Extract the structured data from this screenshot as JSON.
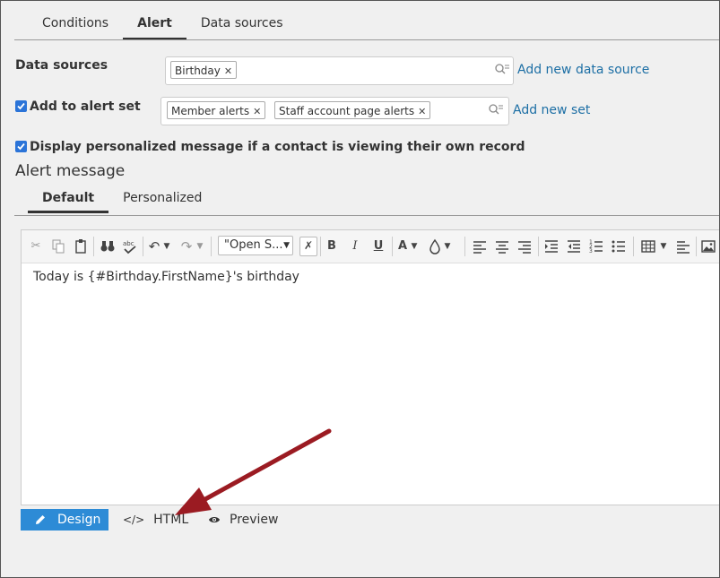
{
  "tabs_top": [
    "Conditions",
    "Alert",
    "Data sources"
  ],
  "active_tab_top": "Alert",
  "data_sources": {
    "label": "Data sources",
    "tags": [
      "Birthday"
    ],
    "add_link": "Add new data source"
  },
  "alert_set": {
    "label": "Add to alert set",
    "checked": true,
    "tags": [
      "Member alerts",
      "Staff account page alerts"
    ],
    "add_link": "Add new set"
  },
  "personalized": {
    "label": "Display personalized message if a contact is viewing their own record",
    "checked": true
  },
  "alert_message": {
    "title": "Alert message",
    "tabs": [
      "Default",
      "Personalized"
    ],
    "active_tab": "Default"
  },
  "editor": {
    "font": "\"Open S...",
    "content": "Today is {#Birthday.FirstName}'s birthday",
    "modes": [
      "Design",
      "HTML",
      "Preview"
    ],
    "active_mode": "Design"
  },
  "colors": {
    "accent": "#2d8bd6",
    "checkbox": "#2b74d8",
    "link": "#1d6fa5",
    "arrow": "#9b1b22"
  }
}
